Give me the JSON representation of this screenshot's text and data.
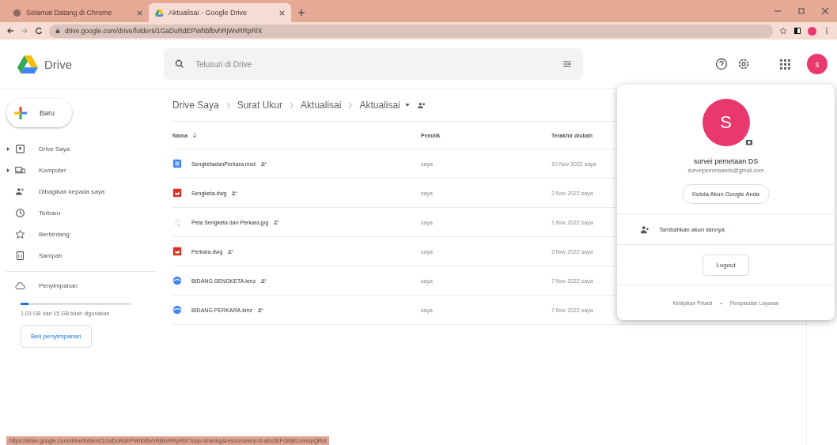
{
  "browser": {
    "tabs": [
      {
        "title": "Selamat Datang di Chrome",
        "selected": false,
        "kind": "chrome"
      },
      {
        "title": "Aktualisai - Google Drive",
        "selected": true,
        "kind": "drive"
      }
    ],
    "url": "drive.google.com/drive/folders/1GaDuRdEPWhbfbvhRjWvRRpRlX"
  },
  "app": {
    "name": "Drive",
    "search": {
      "placeholder": "Telusuri di Drive"
    },
    "avatar": "s"
  },
  "sidebar": {
    "new_button": "Baru",
    "items": [
      {
        "label": "Drive Saya",
        "expandable": true
      },
      {
        "label": "Komputer",
        "expandable": true
      },
      {
        "label": "Dibagikan kepada saya",
        "expandable": false
      },
      {
        "label": "Terbaru",
        "expandable": false
      },
      {
        "label": "Berbintang",
        "expandable": false
      },
      {
        "label": "Sampah",
        "expandable": false
      }
    ],
    "storage": {
      "label": "Penyimpanan",
      "level": 0.07,
      "usage": "1,03 GB dari 15 GB telah digunakan",
      "buy_button": "Beli penyimpanan"
    }
  },
  "breadcrumb": [
    "Drive Saya",
    "Surat Ukur",
    "Aktualisai",
    "Aktualisai"
  ],
  "table": {
    "columns": [
      "Nama",
      "Pemilik",
      "Terakhir diubah"
    ],
    "rows": [
      {
        "name": "SengketadanPerkara.mxd",
        "kind": "doc",
        "owner": "saya",
        "modified": "10 Nov 2022 saya"
      },
      {
        "name": "Sengketa.dwg",
        "kind": "dwg",
        "owner": "saya",
        "modified": "2 Nov 2022 saya"
      },
      {
        "name": "Peta Sengketa dan Perkara.jpg",
        "kind": "image",
        "owner": "saya",
        "modified": "1 Nov 2022 saya"
      },
      {
        "name": "Perkara.dwg",
        "kind": "dwg",
        "owner": "saya",
        "modified": "2 Nov 2022 saya"
      },
      {
        "name": "BIDANG SENGKETA.kmz",
        "kind": "kmz",
        "owner": "saya",
        "modified": "7 Nov 2022 saya"
      },
      {
        "name": "BIDANG PERKARA.kmz",
        "kind": "kmz",
        "owner": "saya",
        "modified": "7 Nov 2022 saya"
      }
    ]
  },
  "account_menu": {
    "avatar": "S",
    "name": "survei pemetaan DS",
    "email": "surveipemetaands@gmail.com",
    "manage_button": "Kelola Akun Google Anda",
    "add_account": "Tambahkan akun lainnya",
    "logout_button": "Logout",
    "privacy_link": "Kebijakan Privasi",
    "separator": "•",
    "terms_link": "Persyaratan Layanan"
  },
  "status_bar": {
    "url": "https://drive.google.com/drive/folders/1GaDuRdEPWhbfbvhRjWvRRpRlX?usp=sharing&resourcekey=0-abcdEFGhijKLmnopQRst"
  }
}
